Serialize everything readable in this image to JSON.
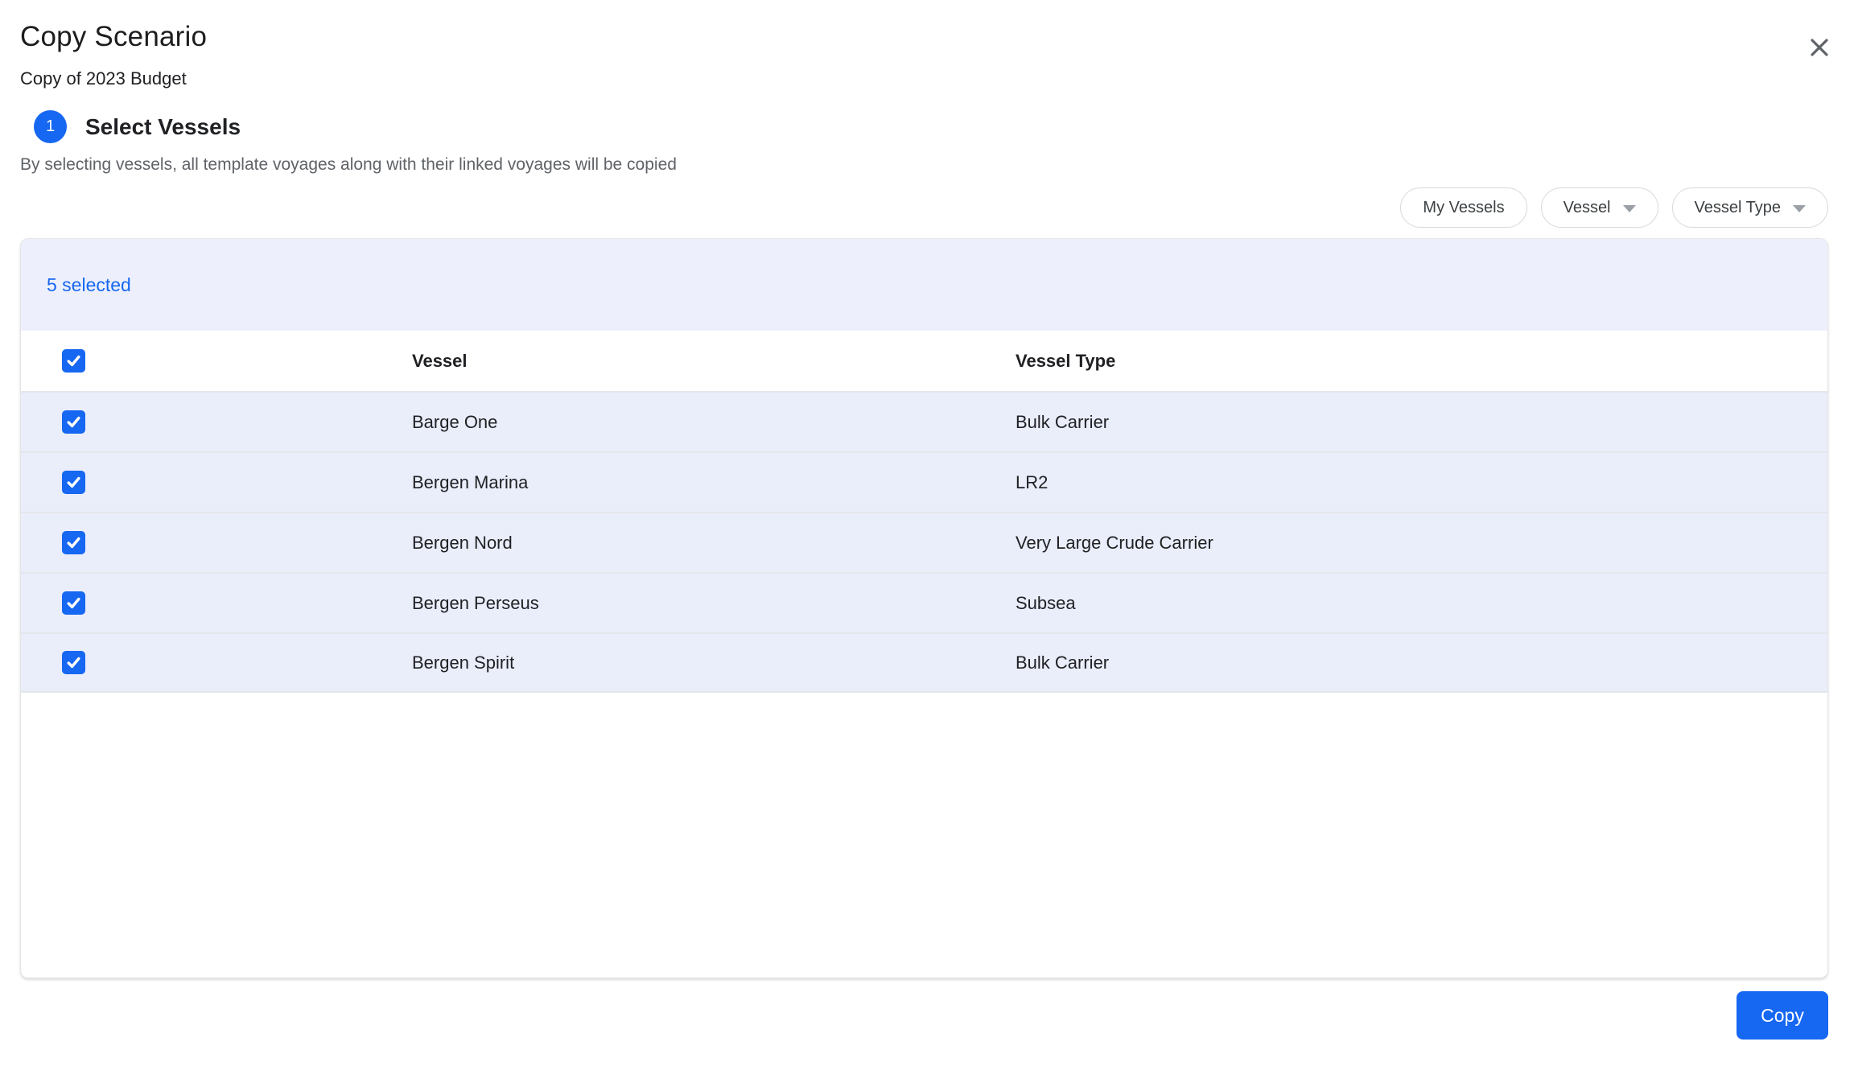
{
  "dialog": {
    "title": "Copy Scenario",
    "subtitle": "Copy of 2023 Budget"
  },
  "step": {
    "number": "1",
    "heading": "Select Vessels",
    "description": "By selecting vessels, all template voyages along with their linked voyages will be copied"
  },
  "filters": {
    "my_vessels_label": "My Vessels",
    "vessel_label": "Vessel",
    "vessel_type_label": "Vessel Type"
  },
  "table": {
    "selected_count_label": "5 selected",
    "columns": {
      "vessel": "Vessel",
      "vessel_type": "Vessel Type"
    },
    "all_checked": true,
    "rows": [
      {
        "vessel": "Barge One",
        "vessel_type": "Bulk Carrier",
        "checked": true
      },
      {
        "vessel": "Bergen Marina",
        "vessel_type": "LR2",
        "checked": true
      },
      {
        "vessel": "Bergen Nord",
        "vessel_type": "Very Large Crude Carrier",
        "checked": true
      },
      {
        "vessel": "Bergen Perseus",
        "vessel_type": "Subsea",
        "checked": true
      },
      {
        "vessel": "Bergen Spirit",
        "vessel_type": "Bulk Carrier",
        "checked": true
      }
    ]
  },
  "footer": {
    "copy_button_label": "Copy"
  },
  "colors": {
    "accent_blue": "#1667f2",
    "selected_bar_bg": "#edf0fc",
    "row_bg": "#eaeefb",
    "muted_text": "#5f6368",
    "selected_text": "#1667f2"
  }
}
